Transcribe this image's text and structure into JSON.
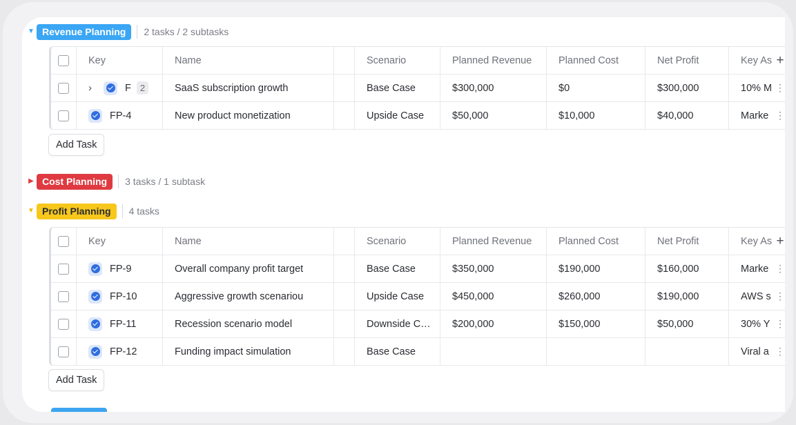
{
  "colors": {
    "revenue": "#3aa6f4",
    "cost": "#df3a41",
    "profit": "#f7c71c",
    "status": "#2f6ee0"
  },
  "columns": [
    "Key",
    "Name",
    "Scenario",
    "Planned Revenue",
    "Planned Cost",
    "Net Profit",
    "Key As"
  ],
  "groups": {
    "revenue": {
      "label": "Revenue Planning",
      "count": "2 tasks / 2 subtasks",
      "rows": [
        {
          "key": "F",
          "subtasks": "2",
          "name": "SaaS subscription growth",
          "scenario": "Base Case",
          "revenue": "$300,000",
          "cost": "$0",
          "profit": "$300,000",
          "assumption": "10% M"
        },
        {
          "key": "FP-4",
          "name": "New product monetization",
          "scenario": "Upside Case",
          "revenue": "$50,000",
          "cost": "$10,000",
          "profit": "$40,000",
          "assumption": "Marke"
        }
      ]
    },
    "cost": {
      "label": "Cost Planning",
      "count": "3 tasks / 1 subtask"
    },
    "profit": {
      "label": "Profit Planning",
      "count": "4 tasks",
      "rows": [
        {
          "key": "FP-9",
          "name": "Overall company profit target",
          "scenario": "Base Case",
          "revenue": "$350,000",
          "cost": "$190,000",
          "profit": "$160,000",
          "assumption": "Marke"
        },
        {
          "key": "FP-10",
          "name": "Aggressive growth scenariou",
          "scenario": "Upside Case",
          "revenue": "$450,000",
          "cost": "$260,000",
          "profit": "$190,000",
          "assumption": "AWS s"
        },
        {
          "key": "FP-11",
          "name": "Recession scenario model",
          "scenario": "Downside C…",
          "revenue": "$200,000",
          "cost": "$150,000",
          "profit": "$50,000",
          "assumption": "30% Y"
        },
        {
          "key": "FP-12",
          "name": "Funding impact simulation",
          "scenario": "Base Case",
          "revenue": "",
          "cost": "",
          "profit": "",
          "assumption": "Viral a"
        }
      ]
    }
  },
  "add_task": "Add Task",
  "icons": {
    "add_column": "+",
    "row_menu": "⋮",
    "expand": "›"
  }
}
